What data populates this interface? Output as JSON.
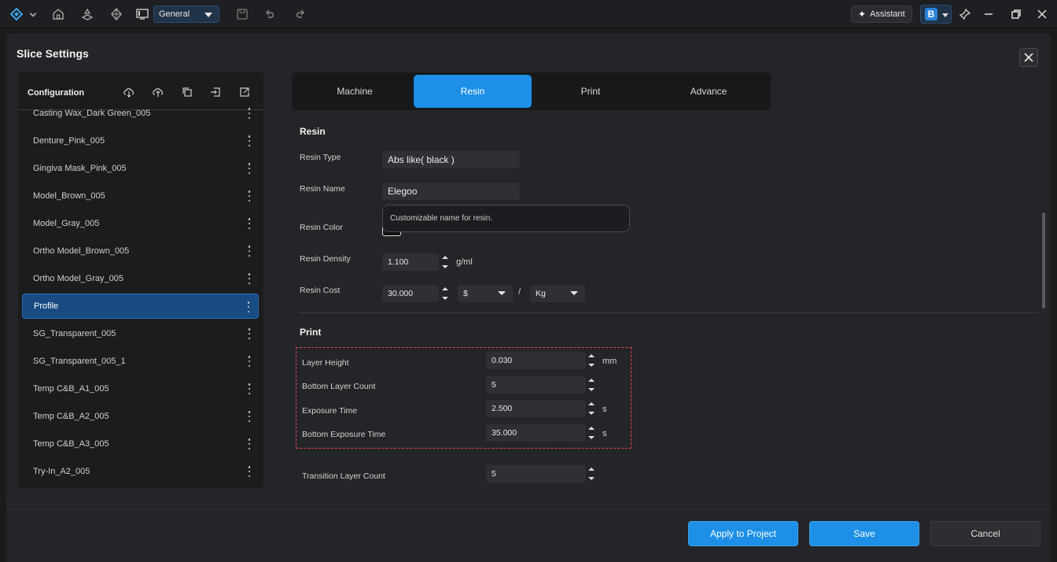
{
  "topbar": {
    "workspace_select": "General",
    "assistant_label": "Assistant",
    "brand_letter": "B"
  },
  "dialog": {
    "title": "Slice Settings"
  },
  "config": {
    "title": "Configuration",
    "items": [
      {
        "label": "Casting Wax_Dark Green_005"
      },
      {
        "label": "Denture_Pink_005"
      },
      {
        "label": "Gingiva Mask_Pink_005"
      },
      {
        "label": "Model_Brown_005"
      },
      {
        "label": "Model_Gray_005"
      },
      {
        "label": "Ortho Model_Brown_005"
      },
      {
        "label": "Ortho Model_Gray_005"
      },
      {
        "label": "Profile",
        "selected": true
      },
      {
        "label": "SG_Transparent_005"
      },
      {
        "label": "SG_Transparent_005_1"
      },
      {
        "label": "Temp C&B_A1_005"
      },
      {
        "label": "Temp C&B_A2_005"
      },
      {
        "label": "Temp C&B_A3_005"
      },
      {
        "label": "Try-In_A2_005"
      }
    ]
  },
  "tabs": [
    {
      "label": "Machine"
    },
    {
      "label": "Resin",
      "active": true
    },
    {
      "label": "Print"
    },
    {
      "label": "Advance"
    }
  ],
  "resin": {
    "section_title": "Resin",
    "type_label": "Resin Type",
    "type_value": "Abs like( black )",
    "name_label": "Resin Name",
    "name_value": "Elegoo",
    "name_tooltip": "Customizable name for resin.",
    "color_label": "Resin Color",
    "density_label": "Resin Density",
    "density_value": "1.100",
    "density_unit": "g/ml",
    "cost_label": "Resin Cost",
    "cost_value": "30.000",
    "currency": "$",
    "separator": "/",
    "weight_unit": "Kg"
  },
  "print": {
    "section_title": "Print",
    "layer_height_label": "Layer Height",
    "layer_height_value": "0.030",
    "layer_height_unit": "mm",
    "bottom_layer_count_label": "Bottom Layer Count",
    "bottom_layer_count_value": "5",
    "exposure_time_label": "Exposure Time",
    "exposure_time_value": "2.500",
    "exposure_time_unit": "s",
    "bottom_exposure_time_label": "Bottom Exposure Time",
    "bottom_exposure_time_value": "35.000",
    "bottom_exposure_time_unit": "s",
    "transition_layer_count_label": "Transition Layer Count",
    "transition_layer_count_value": "5"
  },
  "footer": {
    "apply_label": "Apply to Project",
    "save_label": "Save",
    "cancel_label": "Cancel"
  },
  "colors": {
    "accent": "#1d8fe6",
    "selected_item": "#174b82",
    "highlight_border": "#e0424c"
  }
}
